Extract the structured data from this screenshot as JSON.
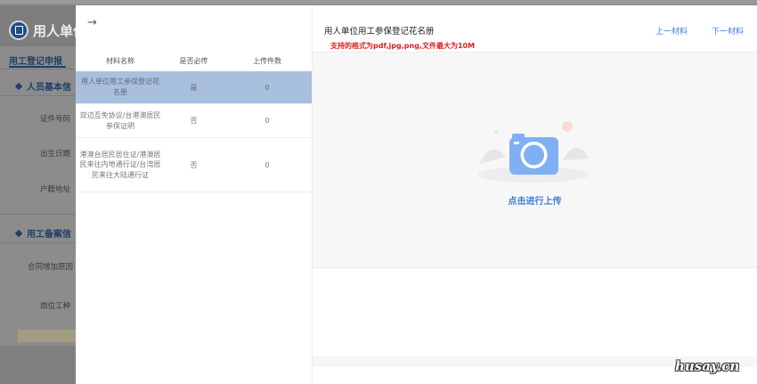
{
  "background": {
    "title": "用人单位",
    "tab": "用工登记申报",
    "section1": "人员基本信",
    "fields": [
      "证件号码",
      "出生日期",
      "户籍地址"
    ],
    "section2": "用工备案信",
    "fields2": [
      "合同增加原因",
      "岗位工种"
    ]
  },
  "drawer": {
    "back_arrow": "→",
    "table": {
      "headers": [
        "材料名称",
        "是否必传",
        "上传件数"
      ],
      "rows": [
        {
          "name": "用人单位用工参保登记花名册",
          "required": "是",
          "count": "0"
        },
        {
          "name": "双边互免协议/台港澳居民参保证明",
          "required": "否",
          "count": "0"
        },
        {
          "name": "港澳台居民居住证/港澳居民来往内地通行证/台湾居民来往大陆通行证",
          "required": "否",
          "count": "0"
        }
      ]
    },
    "doc_title": "用人单位用工参保登记花名册",
    "hint": "支持的格式为pdf,jpg,png,文件最大为10M",
    "prev_label": "上一材料",
    "next_label": "下一材料",
    "upload_label": "点击进行上传"
  },
  "watermark": "husay.cn",
  "colors": {
    "accent": "#3d7ed6",
    "hint_red": "#e02020",
    "selected_row": "#a9bfde",
    "camera_blue": "#7fb0f4"
  }
}
